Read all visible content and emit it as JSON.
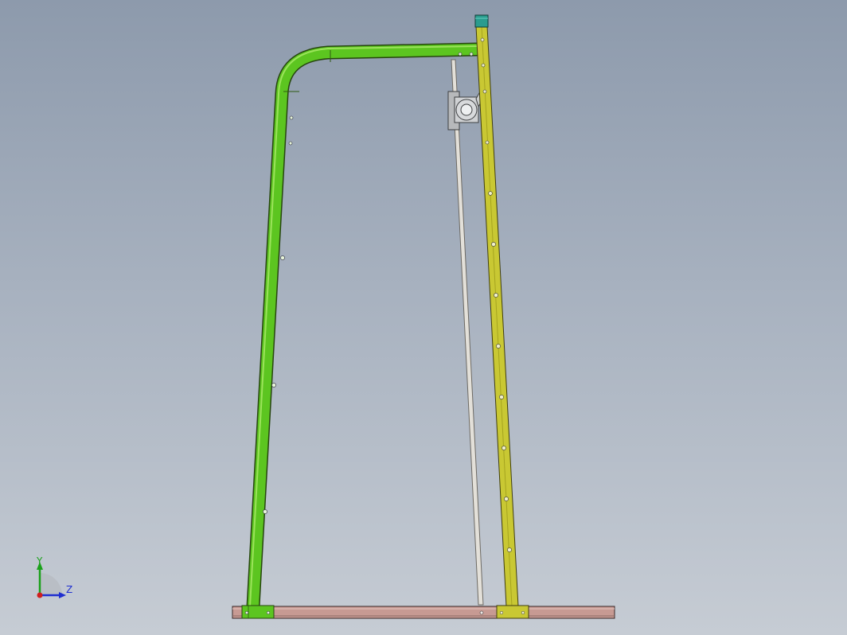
{
  "triad": {
    "y_label": "Y",
    "z_label": "Z",
    "colors": {
      "y": "#1aa11a",
      "z": "#1f2fd0",
      "x": "#d01f1f"
    }
  },
  "model": {
    "parts": [
      {
        "name": "green-frame-tube",
        "color": "#5cc520"
      },
      {
        "name": "yellow-upright-post",
        "color": "#c9c833"
      },
      {
        "name": "teal-end-cap",
        "color": "#2a9c8e"
      },
      {
        "name": "vertical-guide-rod",
        "color": "#d9d6cf"
      },
      {
        "name": "bearing-block",
        "color": "#c2c4c6"
      },
      {
        "name": "base-rail",
        "color": "#c79a93"
      },
      {
        "name": "mounting-plate-left",
        "color": "#5cc520"
      },
      {
        "name": "mounting-plate-right",
        "color": "#c9c833"
      }
    ]
  }
}
